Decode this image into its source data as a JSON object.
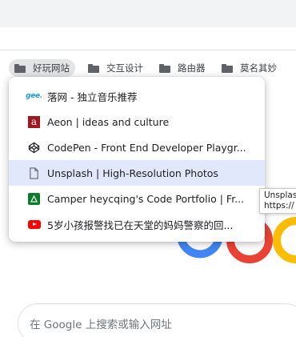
{
  "bookmarks_bar": {
    "folders": [
      {
        "label": "好玩网站",
        "active": true
      },
      {
        "label": "交互设计",
        "active": false
      },
      {
        "label": "路由器",
        "active": false
      },
      {
        "label": "莫名其妙",
        "active": false
      }
    ]
  },
  "dropdown": {
    "items": [
      {
        "label": "落网 - 独立音乐推荐",
        "icon": "gee-icon"
      },
      {
        "label": "Aeon | ideas and culture",
        "icon": "aeon-icon"
      },
      {
        "label": "CodePen - Front End Developer Playgr...",
        "icon": "codepen-icon"
      },
      {
        "label": "Unsplash | High-Resolution Photos",
        "icon": "document-icon",
        "highlighted": true
      },
      {
        "label": "Camper heycqing's Code Portfolio | Fr...",
        "icon": "camper-icon"
      },
      {
        "label": "5岁小孩报警找已在天堂的妈妈警察的回...",
        "icon": "youtube-icon"
      }
    ],
    "gee_text": "gee.",
    "aeon_text": "a"
  },
  "tooltip": {
    "line1": "Unsplas",
    "line2": "https://"
  },
  "search": {
    "placeholder": "在 Google 上搜索或输入网址"
  },
  "colors": {
    "highlight": "#e1e8fc",
    "google_blue": "#4285f4",
    "google_red": "#ea4335",
    "google_yellow": "#fbbc05"
  }
}
